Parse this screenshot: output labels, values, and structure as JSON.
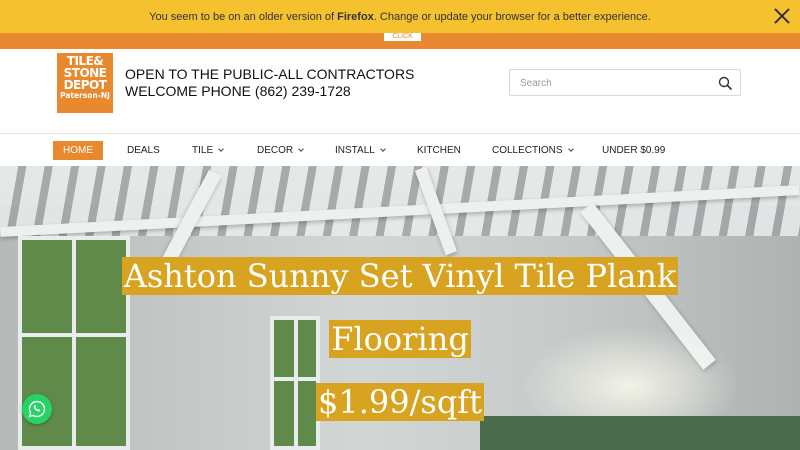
{
  "banner": {
    "text_before": "You seem to be on an older version of ",
    "browser": "Firefox",
    "text_after": ". Change or update your browser for a better experience."
  },
  "click_tab": "CLICK",
  "header": {
    "logo": {
      "line1": "TILE&",
      "line2": "STONE",
      "line3": "DEPOT",
      "line4": "Paterson-NJ"
    },
    "tagline_line1": "OPEN TO THE PUBLIC-ALL CONTRACTORS",
    "tagline_line2": "WELCOME PHONE (862) 239-1728",
    "search": {
      "placeholder": "Search",
      "value": ""
    }
  },
  "nav": {
    "items": [
      {
        "label": "HOME",
        "active": true,
        "dropdown": false
      },
      {
        "label": "DEALS",
        "active": false,
        "dropdown": false
      },
      {
        "label": "TILE",
        "active": false,
        "dropdown": true
      },
      {
        "label": "DECOR",
        "active": false,
        "dropdown": true
      },
      {
        "label": "INSTALL",
        "active": false,
        "dropdown": true
      },
      {
        "label": "KITCHEN",
        "active": false,
        "dropdown": false
      },
      {
        "label": "COLLECTIONS",
        "active": false,
        "dropdown": true
      },
      {
        "label": "UNDER $0.99",
        "active": false,
        "dropdown": false
      }
    ]
  },
  "hero": {
    "line1": "Ashton Sunny Set Vinyl Tile Plank",
    "line2": "Flooring",
    "line3": "$1.99/sqft"
  },
  "icons": {
    "close": "close-icon",
    "search": "search-icon",
    "whatsapp": "whatsapp-icon"
  },
  "colors": {
    "banner": "#f5c12e",
    "accent_orange": "#e8892f",
    "hero_highlight": "#d8a320",
    "whatsapp": "#25d366"
  }
}
